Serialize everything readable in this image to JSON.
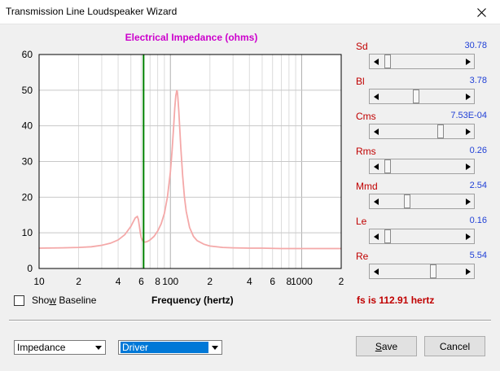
{
  "window": {
    "title": "Transmission Line Loudspeaker Wizard"
  },
  "chart_data": {
    "type": "line",
    "title": "Electrical Impedance (ohms)",
    "xlabel": "Frequency (hertz)",
    "ylabel": "",
    "x_scale": "log",
    "xlim": [
      10,
      2000
    ],
    "ylim": [
      0,
      60
    ],
    "y_ticks": [
      0,
      10,
      20,
      30,
      40,
      50,
      60
    ],
    "x_tick_labels": [
      {
        "x": 10,
        "label": "10"
      },
      {
        "x": 20,
        "label": "2"
      },
      {
        "x": 40,
        "label": "4"
      },
      {
        "x": 60,
        "label": "6"
      },
      {
        "x": 80,
        "label": "8"
      },
      {
        "x": 100,
        "label": "100"
      },
      {
        "x": 200,
        "label": "2"
      },
      {
        "x": 400,
        "label": "4"
      },
      {
        "x": 600,
        "label": "6"
      },
      {
        "x": 800,
        "label": "8"
      },
      {
        "x": 1000,
        "label": "1000"
      },
      {
        "x": 2000,
        "label": "2"
      }
    ],
    "grid": true,
    "marker_line": {
      "x": 62.5,
      "color": "#008000"
    },
    "series": [
      {
        "color": "#f4a8a8",
        "x": [
          10,
          15,
          20,
          25,
          30,
          35,
          40,
          45,
          50,
          52,
          54,
          56,
          57,
          58,
          59,
          60,
          62,
          64,
          66,
          68,
          70,
          75,
          80,
          85,
          90,
          95,
          100,
          103,
          106,
          108,
          110,
          112,
          113,
          114,
          116,
          118,
          120,
          124,
          128,
          132,
          140,
          150,
          160,
          180,
          200,
          250,
          300,
          400,
          500,
          700,
          1000,
          1500,
          2000
        ],
        "y": [
          5.7,
          5.8,
          5.9,
          6.1,
          6.5,
          7.1,
          8.0,
          9.5,
          11.8,
          13.0,
          14.2,
          14.6,
          13.8,
          12.0,
          10.0,
          8.6,
          7.6,
          7.4,
          7.5,
          7.7,
          8.0,
          9.0,
          10.5,
          12.5,
          15.5,
          20.0,
          27.0,
          33.0,
          40.0,
          45.0,
          48.5,
          50.0,
          49.5,
          48.0,
          44.0,
          39.0,
          34.0,
          26.0,
          20.0,
          16.0,
          11.5,
          9.0,
          7.8,
          6.8,
          6.3,
          5.9,
          5.8,
          5.7,
          5.7,
          5.6,
          5.6,
          5.6,
          5.6
        ]
      }
    ]
  },
  "params": [
    {
      "label": "Sd",
      "value": "30.78",
      "position": 0.03
    },
    {
      "label": "Bl",
      "value": "3.78",
      "position": 0.42
    },
    {
      "label": "Cms",
      "value": "7.53E-04",
      "position": 0.76
    },
    {
      "label": "Rms",
      "value": "0.26",
      "position": 0.03
    },
    {
      "label": "Mmd",
      "value": "2.54",
      "position": 0.3
    },
    {
      "label": "Le",
      "value": "0.16",
      "position": 0.03
    },
    {
      "label": "Re",
      "value": "5.54",
      "position": 0.66
    }
  ],
  "baseline": {
    "label": "Show Baseline",
    "checked": false
  },
  "frequency_label": "Frequency (hertz)",
  "fs_text": "fs is 112.91 hertz",
  "type_select": {
    "value": "Impedance"
  },
  "source_select": {
    "value": "Driver"
  },
  "buttons": {
    "save": "Save",
    "cancel": "Cancel"
  },
  "colors": {
    "title": "#cc00cc",
    "param_label": "#c00000",
    "param_value": "#1f3fd6",
    "fs": "#c00000",
    "selection": "#0078d7"
  },
  "icons": {
    "close": "close-icon",
    "scroll_left": "arrow-left-icon",
    "scroll_right": "arrow-right-icon",
    "dropdown": "chevron-down-icon"
  }
}
